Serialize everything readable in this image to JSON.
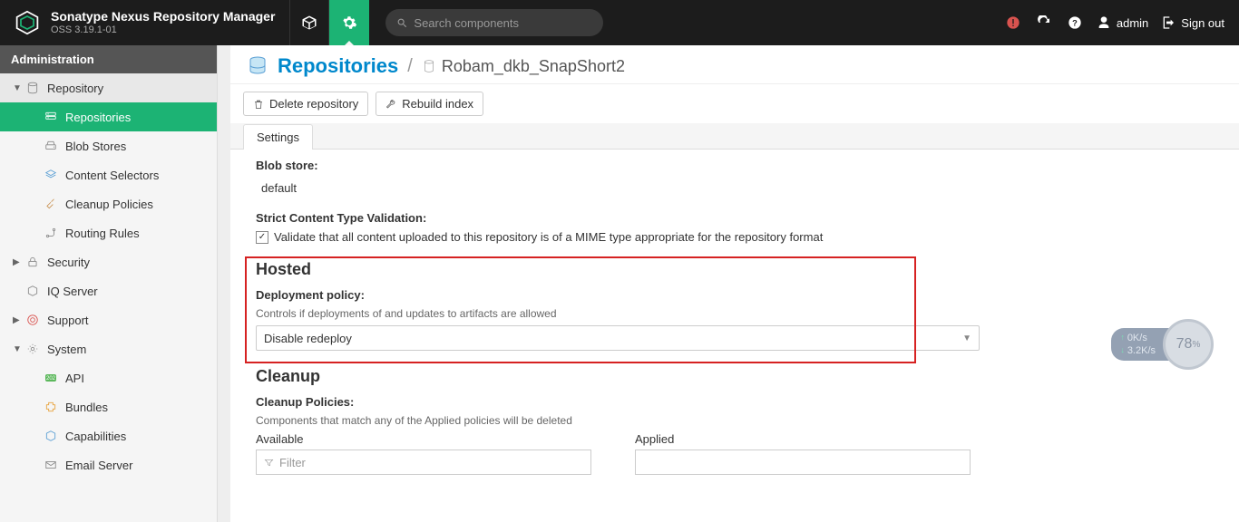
{
  "header": {
    "product_name": "Sonatype Nexus Repository Manager",
    "version": "OSS 3.19.1-01",
    "search_placeholder": "Search components",
    "user": "admin",
    "signout": "Sign out"
  },
  "sidebar": {
    "title": "Administration",
    "repository": {
      "label": "Repository",
      "items": [
        {
          "id": "repositories",
          "label": "Repositories",
          "active": true
        },
        {
          "id": "blob-stores",
          "label": "Blob Stores"
        },
        {
          "id": "content-selectors",
          "label": "Content Selectors"
        },
        {
          "id": "cleanup-policies",
          "label": "Cleanup Policies"
        },
        {
          "id": "routing-rules",
          "label": "Routing Rules"
        }
      ]
    },
    "security": {
      "label": "Security"
    },
    "iq": {
      "label": "IQ Server"
    },
    "support": {
      "label": "Support"
    },
    "system": {
      "label": "System",
      "items": [
        {
          "id": "api",
          "label": "API"
        },
        {
          "id": "bundles",
          "label": "Bundles"
        },
        {
          "id": "capabilities",
          "label": "Capabilities"
        },
        {
          "id": "email-server",
          "label": "Email Server"
        }
      ]
    }
  },
  "breadcrumb": {
    "title": "Repositories",
    "current": "Robam_dkb_SnapShort2"
  },
  "actions": {
    "delete": "Delete repository",
    "rebuild": "Rebuild index"
  },
  "tabs": {
    "settings": "Settings"
  },
  "form": {
    "blobstore_label": "Blob store:",
    "blobstore_value": "default",
    "strict_label": "Strict Content Type Validation:",
    "strict_desc": "Validate that all content uploaded to this repository is of a MIME type appropriate for the repository format",
    "hosted_title": "Hosted",
    "deploy_label": "Deployment policy:",
    "deploy_desc": "Controls if deployments of and updates to artifacts are allowed",
    "deploy_value": "Disable redeploy",
    "cleanup_title": "Cleanup",
    "cleanup_policies_label": "Cleanup Policies:",
    "cleanup_policies_desc": "Components that match any of the Applied policies will be deleted",
    "available_label": "Available",
    "applied_label": "Applied",
    "filter_placeholder": "Filter"
  },
  "monitor": {
    "up": "0K/s",
    "down": "3.2K/s",
    "pct": "78",
    "pct_unit": "%"
  }
}
